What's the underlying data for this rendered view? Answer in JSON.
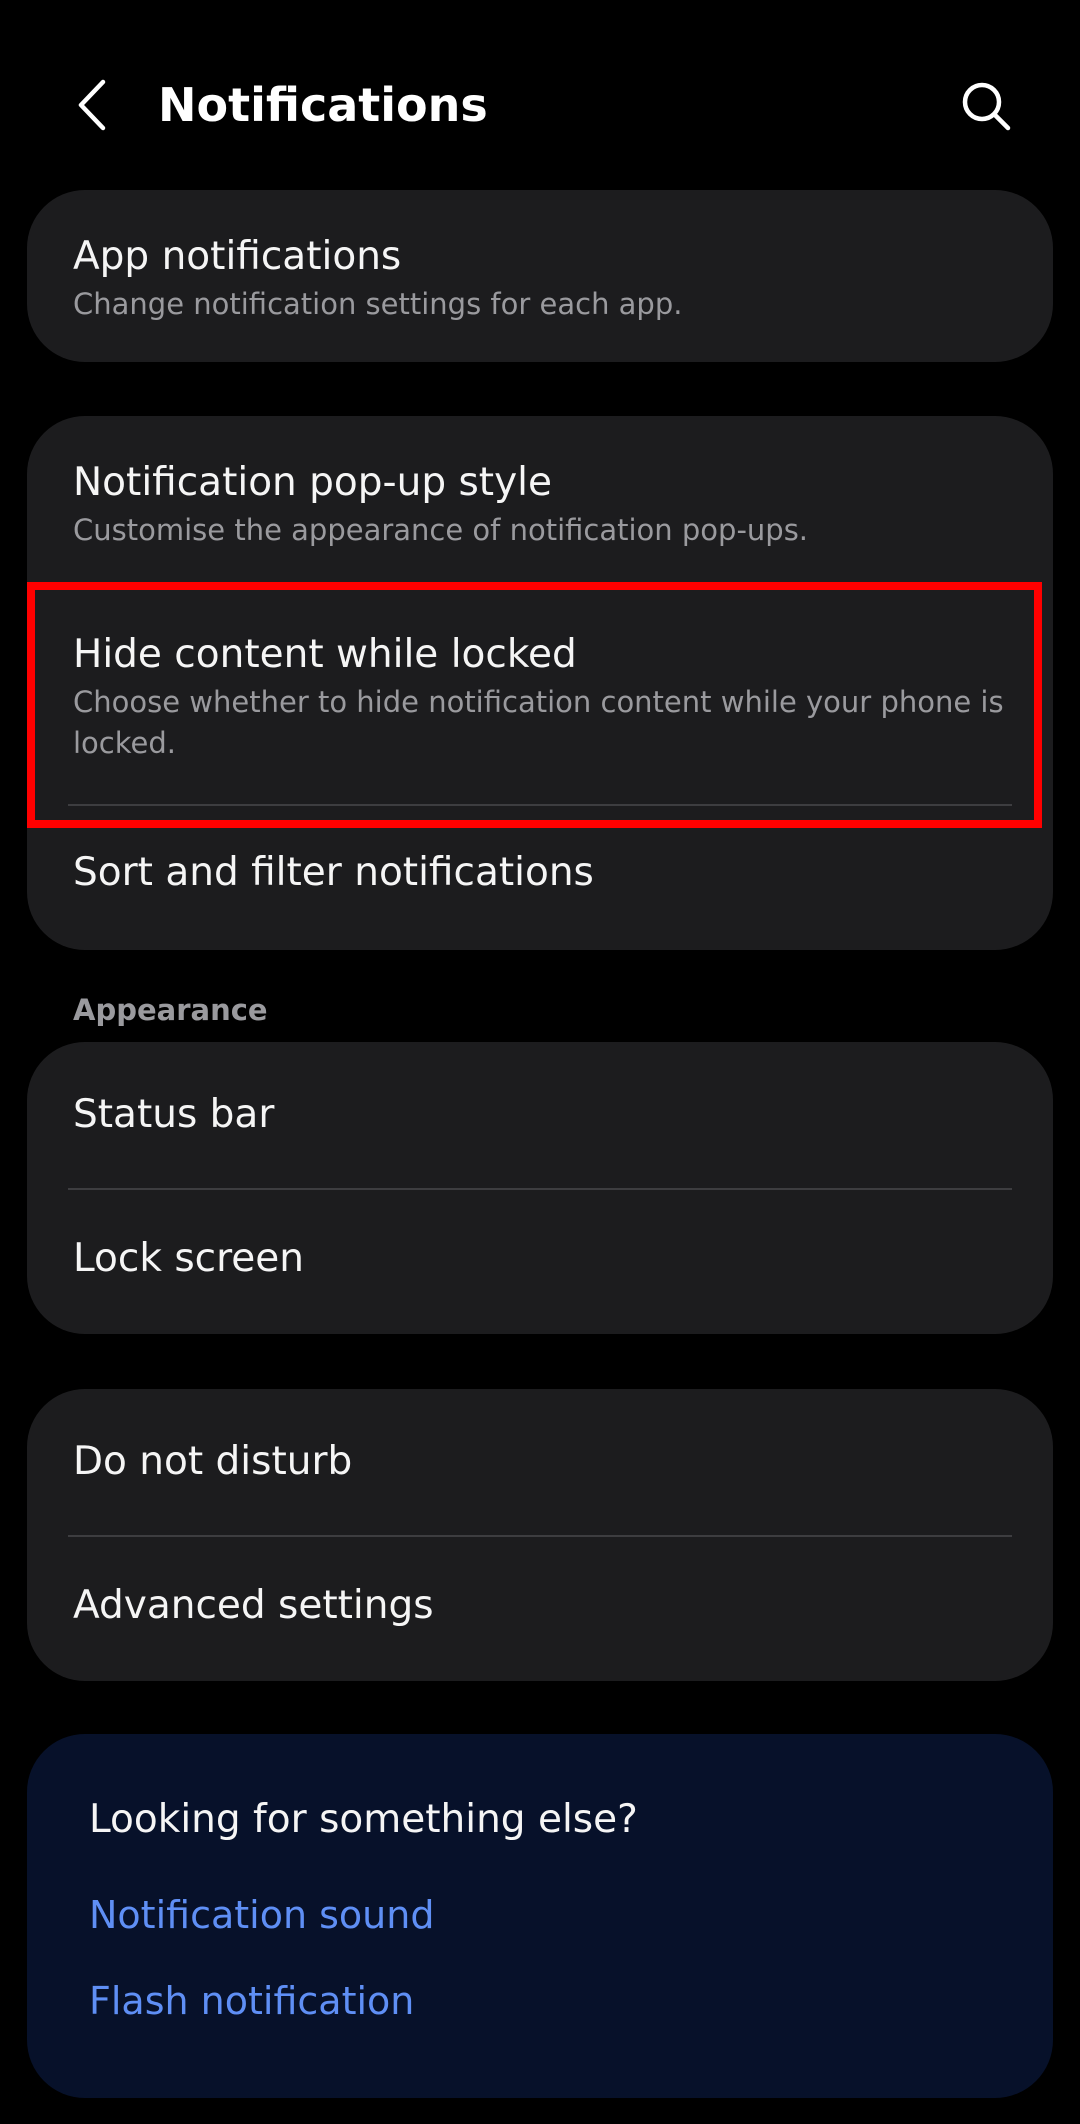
{
  "header": {
    "title": "Notifications",
    "back_icon": "chevron-left-icon",
    "search_icon": "search-icon"
  },
  "card1": {
    "app_notifications": {
      "title": "App notifications",
      "subtitle": "Change notification settings for each app."
    }
  },
  "card2": {
    "popup_style": {
      "title": "Notification pop-up style",
      "subtitle": "Customise the appearance of notification pop-ups."
    },
    "hide_content": {
      "title": "Hide content while locked",
      "subtitle": "Choose whether to hide notification content while your phone is locked."
    },
    "sort_filter": {
      "title": "Sort and filter notifications"
    }
  },
  "appearance": {
    "label": "Appearance",
    "status_bar": "Status bar",
    "lock_screen": "Lock screen"
  },
  "card4": {
    "do_not_disturb": "Do not disturb",
    "advanced_settings": "Advanced settings"
  },
  "suggestions": {
    "title": "Looking for something else?",
    "links": [
      "Notification sound",
      "Flash notification"
    ]
  },
  "colors": {
    "background": "#000000",
    "card": "#1c1c1e",
    "suggest_card": "#07112a",
    "link": "#5f8ff5",
    "highlight": "#ff0000"
  }
}
